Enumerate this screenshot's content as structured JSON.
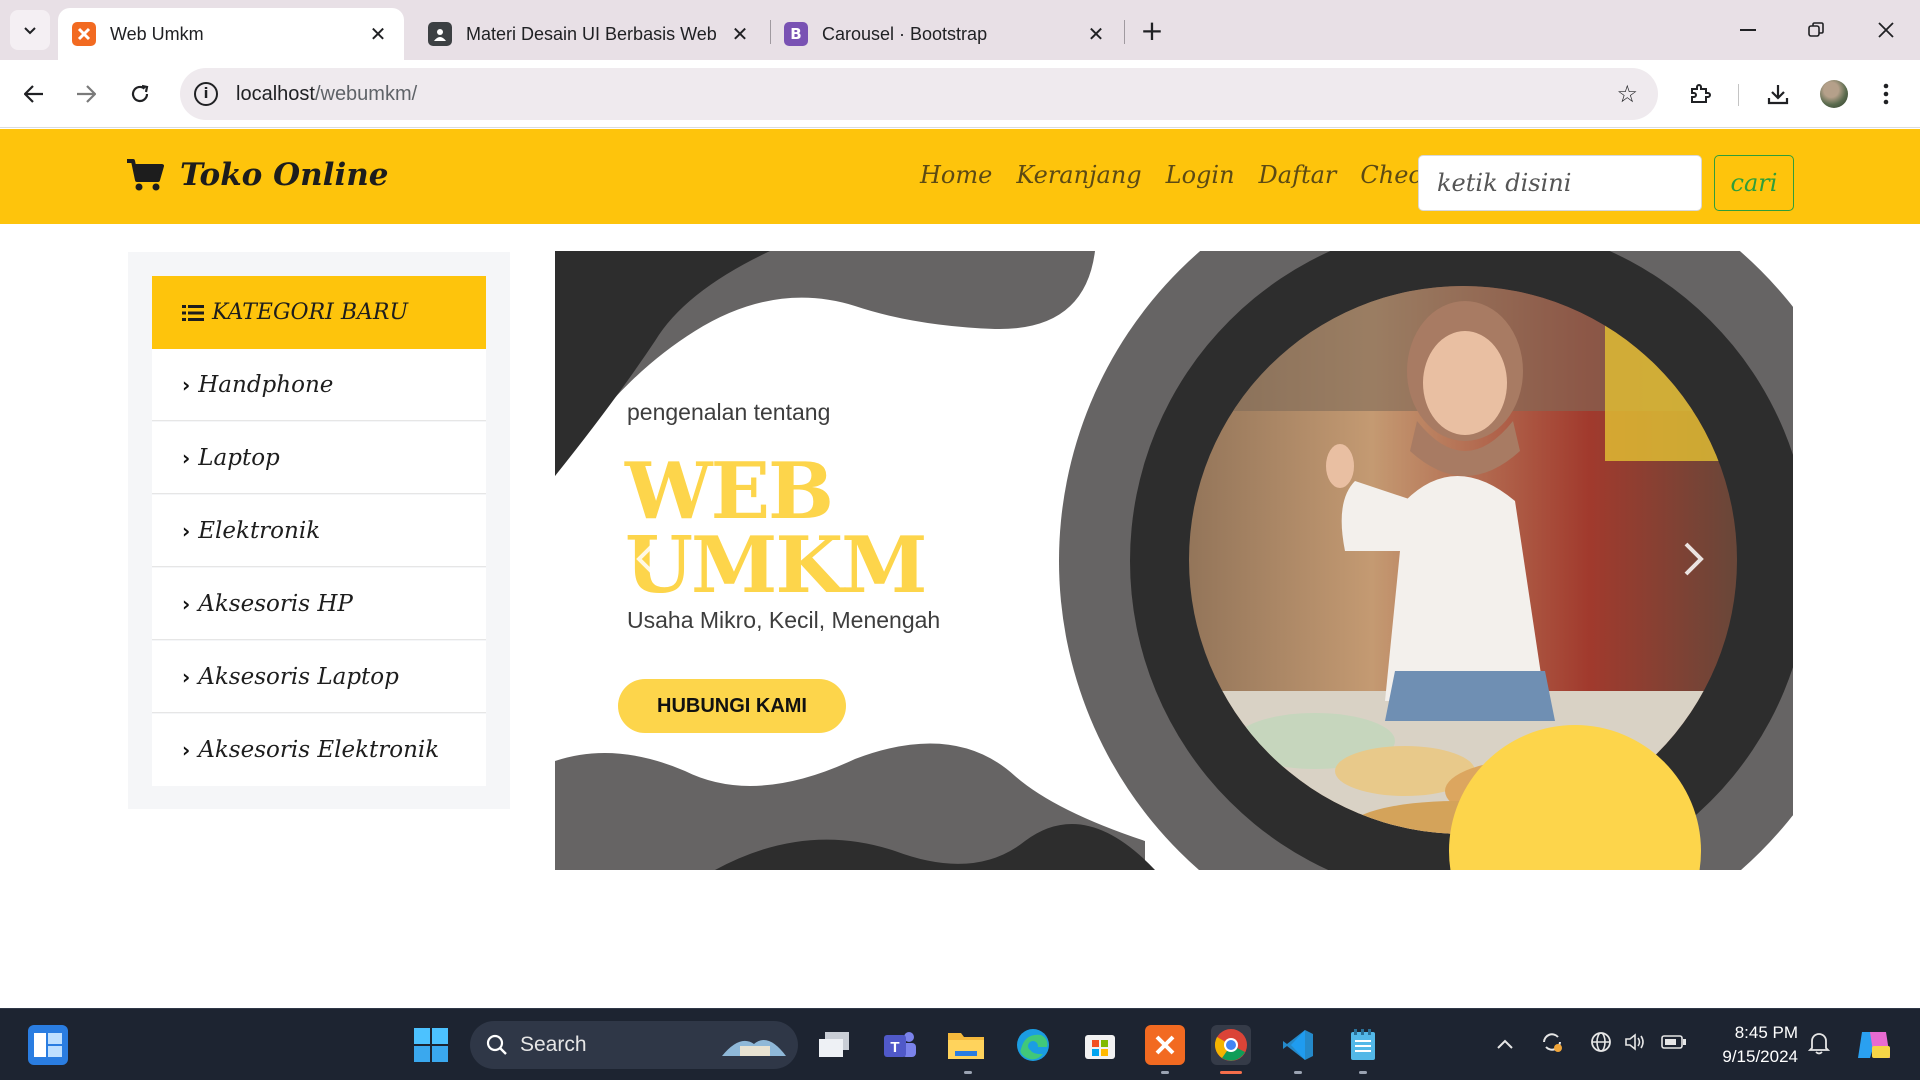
{
  "browser": {
    "tabs": [
      {
        "title": "Web Umkm",
        "active": true,
        "favicon": "xampp-icon",
        "favicon_color": "#f26a21"
      },
      {
        "title": "Materi Desain UI Berbasis Web",
        "active": false,
        "favicon": "classroom-icon",
        "favicon_color": "#3c4043"
      },
      {
        "title": "Carousel · Bootstrap",
        "active": false,
        "favicon": "bootstrap-icon",
        "favicon_color": "#7952b3"
      }
    ],
    "favicon_letters": {
      "bootstrap": "B"
    },
    "url_host": "localhost",
    "url_path": "/webumkm/"
  },
  "site": {
    "brand": "Toko Online",
    "nav": [
      "Home",
      "Keranjang",
      "Login",
      "Daftar",
      "Checkout"
    ],
    "search_placeholder": "ketik disini",
    "search_button": "cari",
    "accent_color": "#fec40c"
  },
  "sidebar": {
    "heading": "KATEGORI BARU",
    "items": [
      "Handphone",
      "Laptop",
      "Elektronik",
      "Aksesoris HP",
      "Aksesoris Laptop",
      "Aksesoris Elektronik"
    ]
  },
  "banner": {
    "intro": "pengenalan tentang",
    "title_line1": "WEB",
    "title_line2": "UMKM",
    "tagline": "Usaha Mikro, Kecil, Menengah",
    "cta": "HUBUNGI KAMI",
    "highlight_color": "#fdd54b"
  },
  "taskbar": {
    "search_label": "Search",
    "time": "8:45 PM",
    "date": "9/15/2024"
  }
}
